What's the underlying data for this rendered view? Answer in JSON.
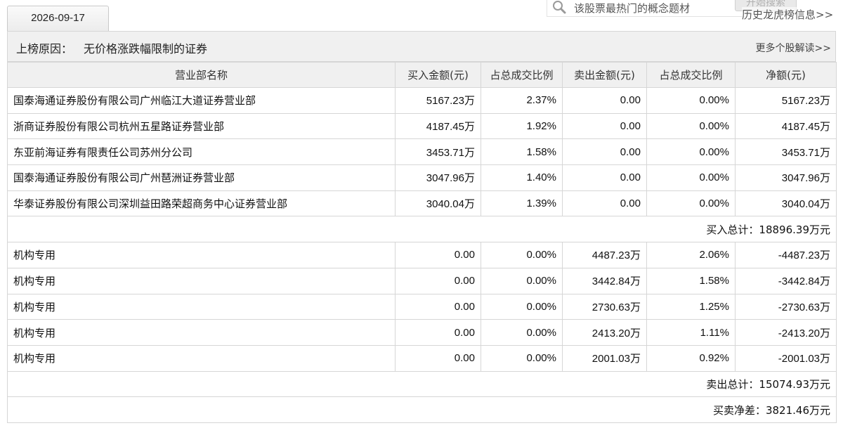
{
  "date_tab": "2026-09-17",
  "search": {
    "placeholder": "该股票最热门的概念题材",
    "button": "开始搜索"
  },
  "history_link": "历史龙虎榜信息>>",
  "reason": {
    "label": "上榜原因：",
    "text": "无价格涨跌幅限制的证券",
    "more_link": "更多个股解读>>"
  },
  "table": {
    "headers": [
      "营业部名称",
      "买入金额(元)",
      "占总成交比例",
      "卖出金额(元)",
      "占总成交比例",
      "净额(元)"
    ],
    "buy_rows": [
      {
        "name": "国泰海通证券股份有限公司广州临江大道证券营业部",
        "buy": "5167.23万",
        "buy_pct": "2.37%",
        "sell": "0.00",
        "sell_pct": "0.00%",
        "net": "5167.23万"
      },
      {
        "name": "浙商证券股份有限公司杭州五星路证券营业部",
        "buy": "4187.45万",
        "buy_pct": "1.92%",
        "sell": "0.00",
        "sell_pct": "0.00%",
        "net": "4187.45万"
      },
      {
        "name": "东亚前海证券有限责任公司苏州分公司",
        "buy": "3453.71万",
        "buy_pct": "1.58%",
        "sell": "0.00",
        "sell_pct": "0.00%",
        "net": "3453.71万"
      },
      {
        "name": "国泰海通证券股份有限公司广州琶洲证券营业部",
        "buy": "3047.96万",
        "buy_pct": "1.40%",
        "sell": "0.00",
        "sell_pct": "0.00%",
        "net": "3047.96万"
      },
      {
        "name": "华泰证券股份有限公司深圳益田路荣超商务中心证券营业部",
        "buy": "3040.04万",
        "buy_pct": "1.39%",
        "sell": "0.00",
        "sell_pct": "0.00%",
        "net": "3040.04万"
      }
    ],
    "buy_total": {
      "label": "买入总计：",
      "value": "18896.39万元"
    },
    "sell_rows": [
      {
        "name": "机构专用",
        "buy": "0.00",
        "buy_pct": "0.00%",
        "sell": "4487.23万",
        "sell_pct": "2.06%",
        "net": "-4487.23万"
      },
      {
        "name": "机构专用",
        "buy": "0.00",
        "buy_pct": "0.00%",
        "sell": "3442.84万",
        "sell_pct": "1.58%",
        "net": "-3442.84万"
      },
      {
        "name": "机构专用",
        "buy": "0.00",
        "buy_pct": "0.00%",
        "sell": "2730.63万",
        "sell_pct": "1.25%",
        "net": "-2730.63万"
      },
      {
        "name": "机构专用",
        "buy": "0.00",
        "buy_pct": "0.00%",
        "sell": "2413.20万",
        "sell_pct": "1.11%",
        "net": "-2413.20万"
      },
      {
        "name": "机构专用",
        "buy": "0.00",
        "buy_pct": "0.00%",
        "sell": "2001.03万",
        "sell_pct": "0.92%",
        "net": "-2001.03万"
      }
    ],
    "sell_total": {
      "label": "卖出总计：",
      "value": "15074.93万元"
    },
    "net_diff": {
      "label": "买卖净差：",
      "value": "3821.46万元"
    }
  }
}
